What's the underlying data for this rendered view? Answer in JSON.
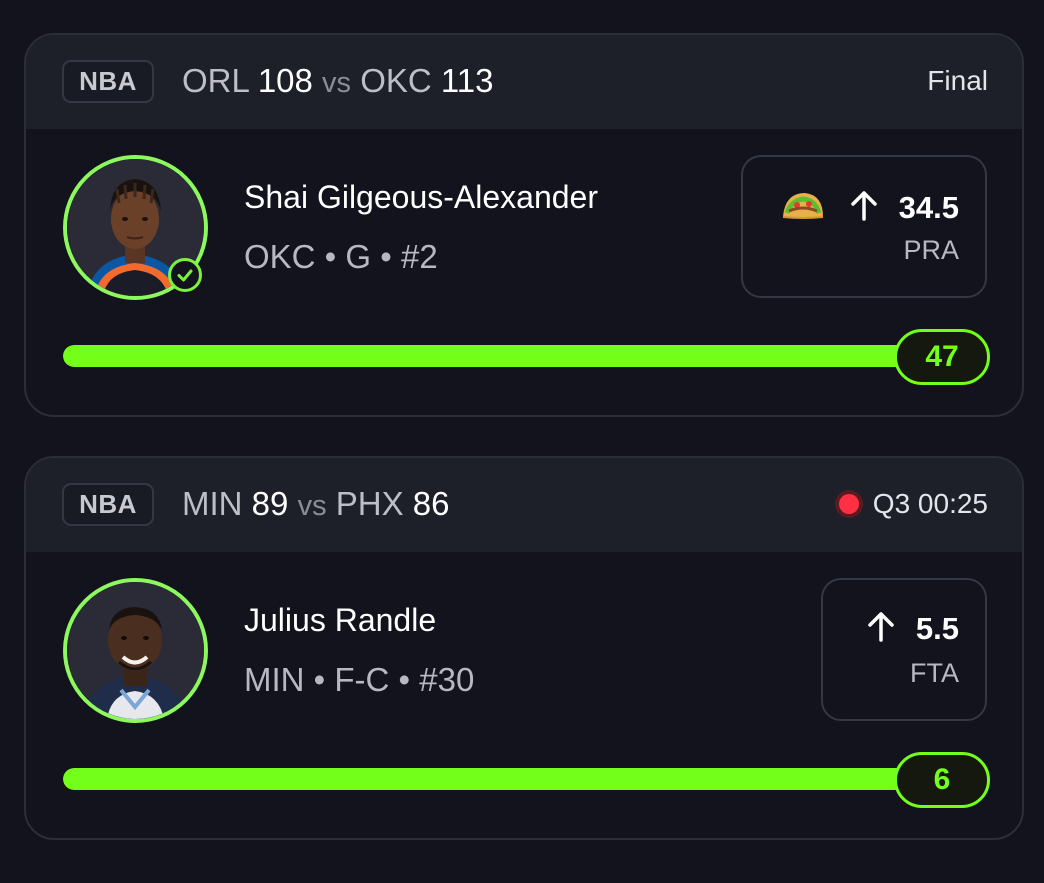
{
  "cards": [
    {
      "league": "NBA",
      "home_team": "ORL",
      "home_score": "108",
      "vs": "vs",
      "away_team": "OKC",
      "away_score": "113",
      "status": "Final",
      "live": false,
      "player": {
        "name": "Shai Gilgeous-Alexander",
        "meta": "OKC • G • #2",
        "avatar_icon": "player-headshot",
        "status_icon": "check-circle-icon"
      },
      "prop": {
        "emoji": "🌮",
        "direction_icon": "arrow-up-icon",
        "line": "34.5",
        "stat": "PRA"
      },
      "progress": {
        "value": "47",
        "fraction": 1.0
      }
    },
    {
      "league": "NBA",
      "home_team": "MIN",
      "home_score": "89",
      "vs": "vs",
      "away_team": "PHX",
      "away_score": "86",
      "status": "Q3 00:25",
      "live": true,
      "player": {
        "name": "Julius Randle",
        "meta": "MIN • F-C • #30",
        "avatar_icon": "player-headshot"
      },
      "prop": {
        "direction_icon": "arrow-up-icon",
        "line": "5.5",
        "stat": "FTA"
      },
      "progress": {
        "value": "6",
        "fraction": 1.0
      }
    }
  ],
  "colors": {
    "background": "#12131c",
    "header": "#1d1f29",
    "accent": "#73ff1a",
    "live": "#ff3044"
  }
}
